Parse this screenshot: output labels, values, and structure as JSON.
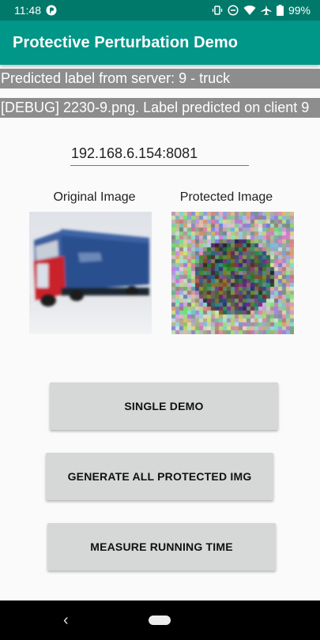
{
  "status_bar": {
    "time": "11:48",
    "battery": "99%",
    "icons": [
      "app-notification-icon",
      "vibrate-icon",
      "do-not-disturb-icon",
      "wifi-icon",
      "airplane-icon",
      "battery-icon"
    ]
  },
  "app_bar": {
    "title": "Protective Perturbation Demo"
  },
  "server_result": "Predicted label from server: 9 - truck",
  "debug_result": "[DEBUG] 2230-9.png. Label predicted on client 9",
  "server_address": {
    "value": "192.168.6.154:8081"
  },
  "images": {
    "original_caption": "Original Image",
    "protected_caption": "Protected Image"
  },
  "buttons": {
    "single_demo": "SINGLE DEMO",
    "generate_all": "GENERATE ALL PROTECTED IMG",
    "measure_time": "MEASURE RUNNING TIME"
  },
  "nav": {
    "back_icon": "back-icon",
    "home_icon": "home-pill-icon"
  },
  "colors": {
    "status_bar": "#00796b",
    "app_bar": "#009688",
    "info_bar": "#8d8d8d",
    "button": "#d6d7d7"
  }
}
